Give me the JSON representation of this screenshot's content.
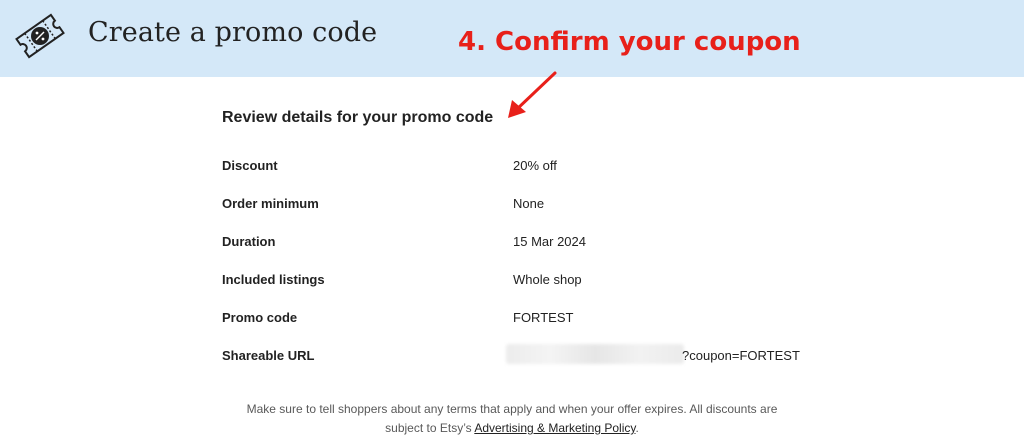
{
  "header": {
    "icon": "coupon-ticket-icon",
    "title": "Create a promo code",
    "background_color": "#d4e8f8"
  },
  "annotation": {
    "text": "4. Confirm your coupon",
    "color": "#e8201a",
    "arrow_icon": "red-arrow-icon"
  },
  "review": {
    "title": "Review details for your promo code",
    "rows": [
      {
        "label": "Discount",
        "value": "20% off"
      },
      {
        "label": "Order minimum",
        "value": "None"
      },
      {
        "label": "Duration",
        "value": "15 Mar 2024"
      },
      {
        "label": "Included listings",
        "value": "Whole shop"
      },
      {
        "label": "Promo code",
        "value": "FORTEST"
      },
      {
        "label": "Shareable URL",
        "value": "?coupon=FORTEST"
      }
    ]
  },
  "footer": {
    "line1": "Make sure to tell shoppers about any terms that apply and when your offer expires. All discounts are",
    "line2_prefix": "subject to Etsy’s",
    "link_text": "Advertising & Marketing Policy",
    "line2_suffix": "."
  }
}
